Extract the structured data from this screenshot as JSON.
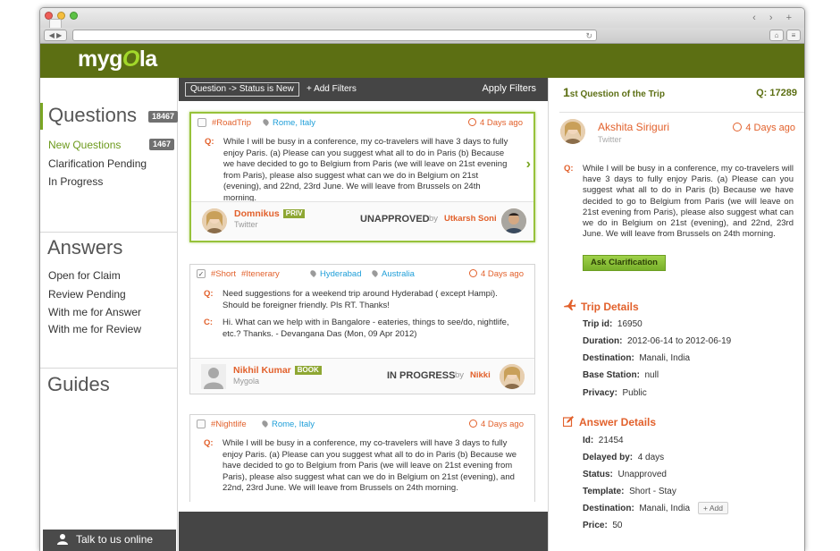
{
  "brand": {
    "logo_pre": "myg",
    "logo_mid": "O",
    "logo_post": "la"
  },
  "sidebar": {
    "questions": {
      "title": "Questions",
      "count": "18467",
      "items": [
        {
          "label": "New Questions",
          "count": "1467"
        },
        {
          "label": "Clarification Pending"
        },
        {
          "label": "In Progress"
        }
      ]
    },
    "answers": {
      "title": "Answers",
      "items": [
        {
          "label": "Open for Claim"
        },
        {
          "label": "Review Pending"
        },
        {
          "label": "With me for Answer"
        },
        {
          "label": "With me for Review"
        }
      ]
    },
    "guides": {
      "title": "Guides"
    },
    "talk": "Talk to us online"
  },
  "filters": {
    "chip": "Question -> Status is New",
    "add": "+ Add Filters",
    "apply": "Apply Filters"
  },
  "cards": [
    {
      "tags": [
        "#RoadTrip"
      ],
      "locations": [
        "Rome, Italy"
      ],
      "time": "4 Days ago",
      "q_label": "Q:",
      "question": "While I will be busy in a conference, my co-travelers will have 3 days to fully enjoy Paris. (a) Please can you suggest what all to do in Paris (b) Because we have decided to go to Belgium from Paris (we will leave on 21st evening from Paris), please also suggest what can we do in Belgium on 21st (evening), and 22nd, 23rd June. We will leave from Brussels on 24th morning.",
      "author": "Domnikus",
      "badge": "PRIV",
      "source": "Twitter",
      "status": "UNAPPROVED",
      "by": "by",
      "assignee": "Utkarsh Soni"
    },
    {
      "tags": [
        "#Short",
        "#Itenerary"
      ],
      "locations": [
        "Hyderabad",
        "Australia"
      ],
      "time": "4 Days ago",
      "q_label": "Q:",
      "question": "Need suggestions for a weekend trip around Hyderabad ( except Hampi). Should be foreigner friendly. Pls RT. Thanks!",
      "c_label": "C:",
      "comment": "Hi. What can we help with in Bangalore - eateries, things to see/do, nightlife, etc.? Thanks. - Devangana Das (Mon, 09 Apr 2012)",
      "author": "Nikhil Kumar",
      "badge": "BOOK",
      "source": "Mygola",
      "status": "IN PROGRESS",
      "by": "by",
      "assignee": "Nikki"
    },
    {
      "tags": [
        "#Nightlife"
      ],
      "locations": [
        "Rome, Italy"
      ],
      "time": "4 Days ago",
      "q_label": "Q:",
      "question": "While I will be busy in a conference, my co-travelers will have 3 days to fully enjoy Paris. (a) Please can you suggest what all to do in Paris (b) Because we have decided to go to Belgium from Paris (we will leave on 21st evening from Paris), please also suggest what can we do in Belgium on 21st (evening), and 22nd, 23rd June. We will leave from Brussels on 24th morning."
    }
  ],
  "detail": {
    "order_num": "1",
    "order_suffix": "st",
    "order_text": " Question of the Trip",
    "qid": "Q: 17289",
    "author": "Akshita Siriguri",
    "source": "Twitter",
    "time": "4 Days ago",
    "q_label": "Q:",
    "question": "While I will be busy in a conference, my co-travelers will have 3 days to fully enjoy Paris. (a) Please can you suggest what all to do in Paris (b) Because we have decided to go to Belgium from Paris (we will leave on 21st evening from Paris), please also suggest what can we do in Belgium on 21st (evening), and 22nd, 23rd June. We will leave from Brussels on 24th morning.",
    "ask_btn": "Ask Clarification",
    "trip": {
      "title": "Trip Details",
      "rows": [
        {
          "k": "Trip id:",
          "v": "16950"
        },
        {
          "k": "Duration:",
          "v": "2012-06-14 to 2012-06-19"
        },
        {
          "k": "Destination:",
          "v": "Manali, India"
        },
        {
          "k": "Base Station:",
          "v": "null"
        },
        {
          "k": "Privacy:",
          "v": "Public"
        }
      ]
    },
    "answer": {
      "title": "Answer Details",
      "rows": [
        {
          "k": "Id:",
          "v": "21454"
        },
        {
          "k": "Delayed by:",
          "v": "4 days"
        },
        {
          "k": "Status:",
          "v": "Unapproved"
        },
        {
          "k": "Template:",
          "v": "Short - Stay"
        },
        {
          "k": "Destination:",
          "v": "Manali, India"
        },
        {
          "k": "Price:",
          "v": "50"
        }
      ],
      "add": "+ Add"
    }
  },
  "colors": {
    "header": "#5c6f13",
    "accent": "#e2612c",
    "link": "#1e9ed8",
    "green": "#7aa624"
  }
}
